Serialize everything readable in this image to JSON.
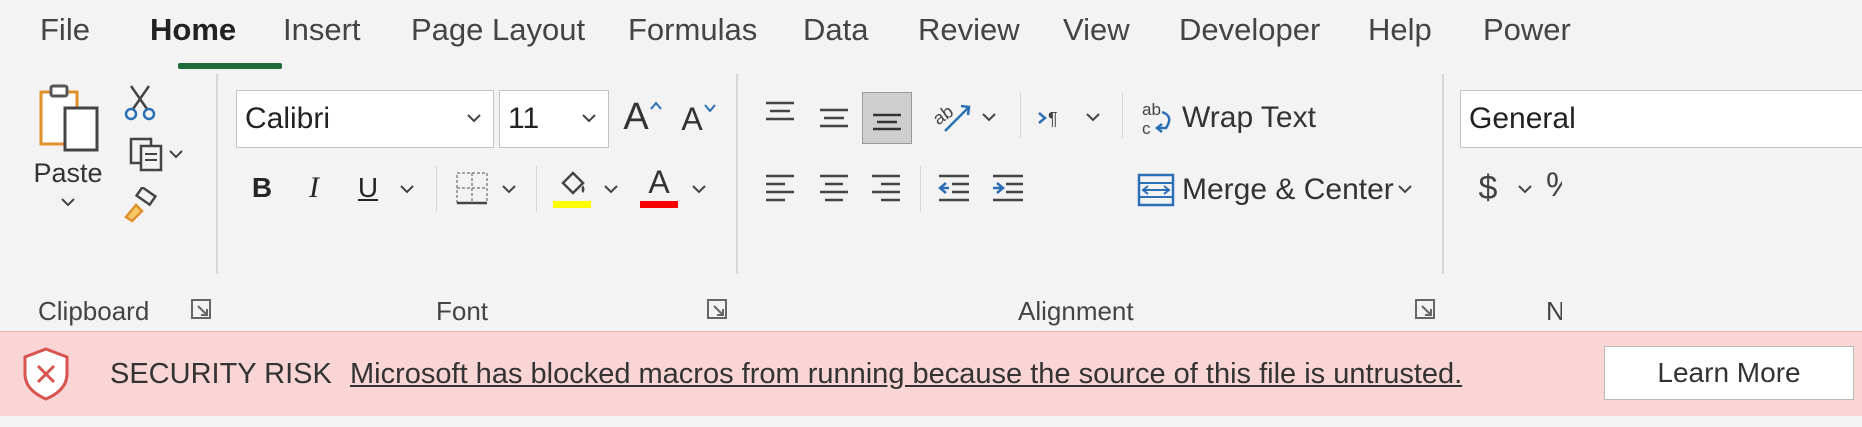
{
  "tabs": [
    {
      "label": "File"
    },
    {
      "label": "Home"
    },
    {
      "label": "Insert"
    },
    {
      "label": "Page Layout"
    },
    {
      "label": "Formulas"
    },
    {
      "label": "Data"
    },
    {
      "label": "Review"
    },
    {
      "label": "View"
    },
    {
      "label": "Developer"
    },
    {
      "label": "Help"
    },
    {
      "label": "Power"
    }
  ],
  "active_tab": "Home",
  "clipboard": {
    "paste_label": "Paste",
    "group_label": "Clipboard"
  },
  "font": {
    "font_name": "Calibri",
    "font_size": "11",
    "bold_label": "B",
    "italic_label": "I",
    "underline_label": "U",
    "grow_label": "A",
    "shrink_label": "A",
    "font_color_label": "A",
    "group_label": "Font",
    "fill_color": "#ffff00",
    "font_color": "#ff0000"
  },
  "alignment": {
    "wrap_text_label": "Wrap Text",
    "merge_center_label": "Merge & Center",
    "group_label": "Alignment",
    "wrap_icon_text": "ab"
  },
  "number": {
    "format_value": "General",
    "currency_symbol": "$",
    "group_label_partial": "N"
  },
  "security_bar": {
    "title": "SECURITY RISK",
    "message": "Microsoft has blocked macros from running because the source of this file is untrusted.",
    "learn_more_label": "Learn More",
    "accent_color": "#d9534f"
  }
}
